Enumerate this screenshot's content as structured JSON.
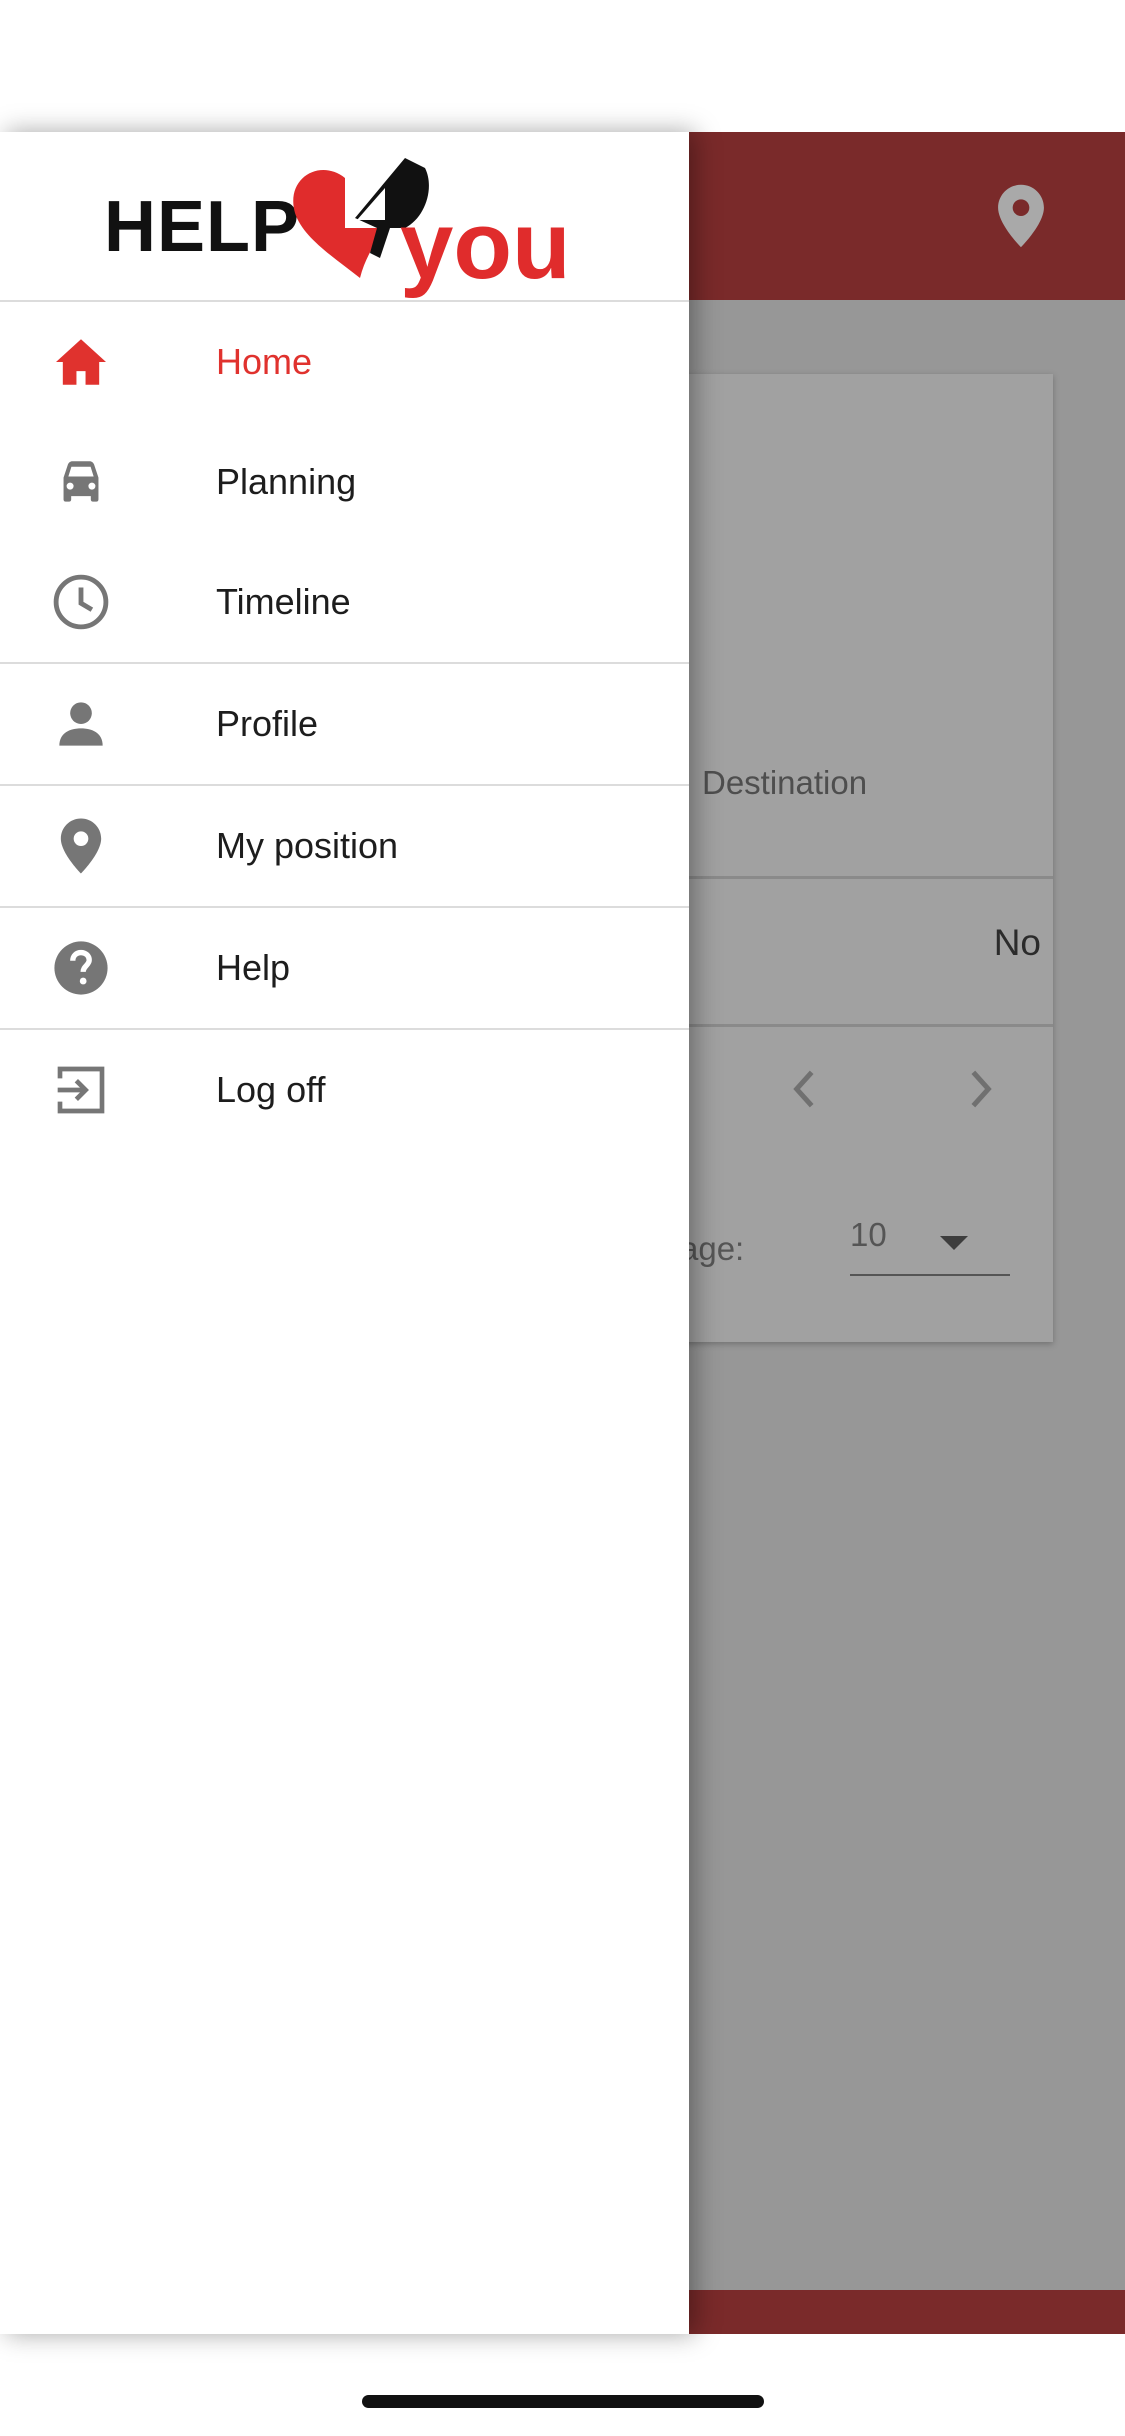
{
  "colors": {
    "accent": "#e0322e",
    "header_background": "#7a2a2a",
    "overlay": "#979797",
    "icon_gray": "#767676"
  },
  "logo": {
    "text_left": "HELP",
    "text_right": "you",
    "icon": "heart-logo-icon"
  },
  "menu": {
    "items": [
      {
        "label": "Home",
        "icon": "home-icon",
        "active": true
      },
      {
        "label": "Planning",
        "icon": "car-icon"
      },
      {
        "label": "Timeline",
        "icon": "clock-icon"
      },
      {
        "label": "Profile",
        "icon": "person-icon"
      },
      {
        "label": "My position",
        "icon": "location-pin-icon"
      },
      {
        "label": "Help",
        "icon": "help-circle-icon"
      },
      {
        "label": "Log off",
        "icon": "logout-icon"
      }
    ]
  },
  "background": {
    "header_icon": "location-pin-icon",
    "table": {
      "column_header": "Destination",
      "cell_value": "No"
    },
    "pagination": {
      "per_page_label": "age:",
      "per_page_value": "10"
    }
  }
}
